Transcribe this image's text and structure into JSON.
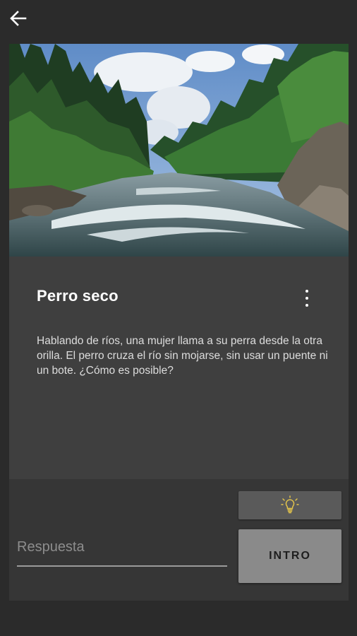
{
  "header": {
    "back_icon": "arrow-left-icon"
  },
  "hero": {
    "image_description": "river flowing between forested banks",
    "icon": "river-photo"
  },
  "riddle": {
    "title": "Perro seco",
    "menu_icon": "more-vert-icon",
    "text": "Hablando de ríos, una mujer llama a su perra desde la otra orilla. El perro cruza el río sin mojarse, sin usar un puente ni un bote. ¿Cómo es posible?"
  },
  "answer": {
    "placeholder": "Respuesta",
    "value": "",
    "hint_icon": "lightbulb-icon",
    "submit_label": "INTRO"
  },
  "colors": {
    "background": "#2b2b2b",
    "card": "#3f3f3f",
    "answer_panel": "#363636",
    "hint_button": "#5a5a5a",
    "submit_button": "#8a8a8a",
    "bulb": "#e8c84a"
  }
}
